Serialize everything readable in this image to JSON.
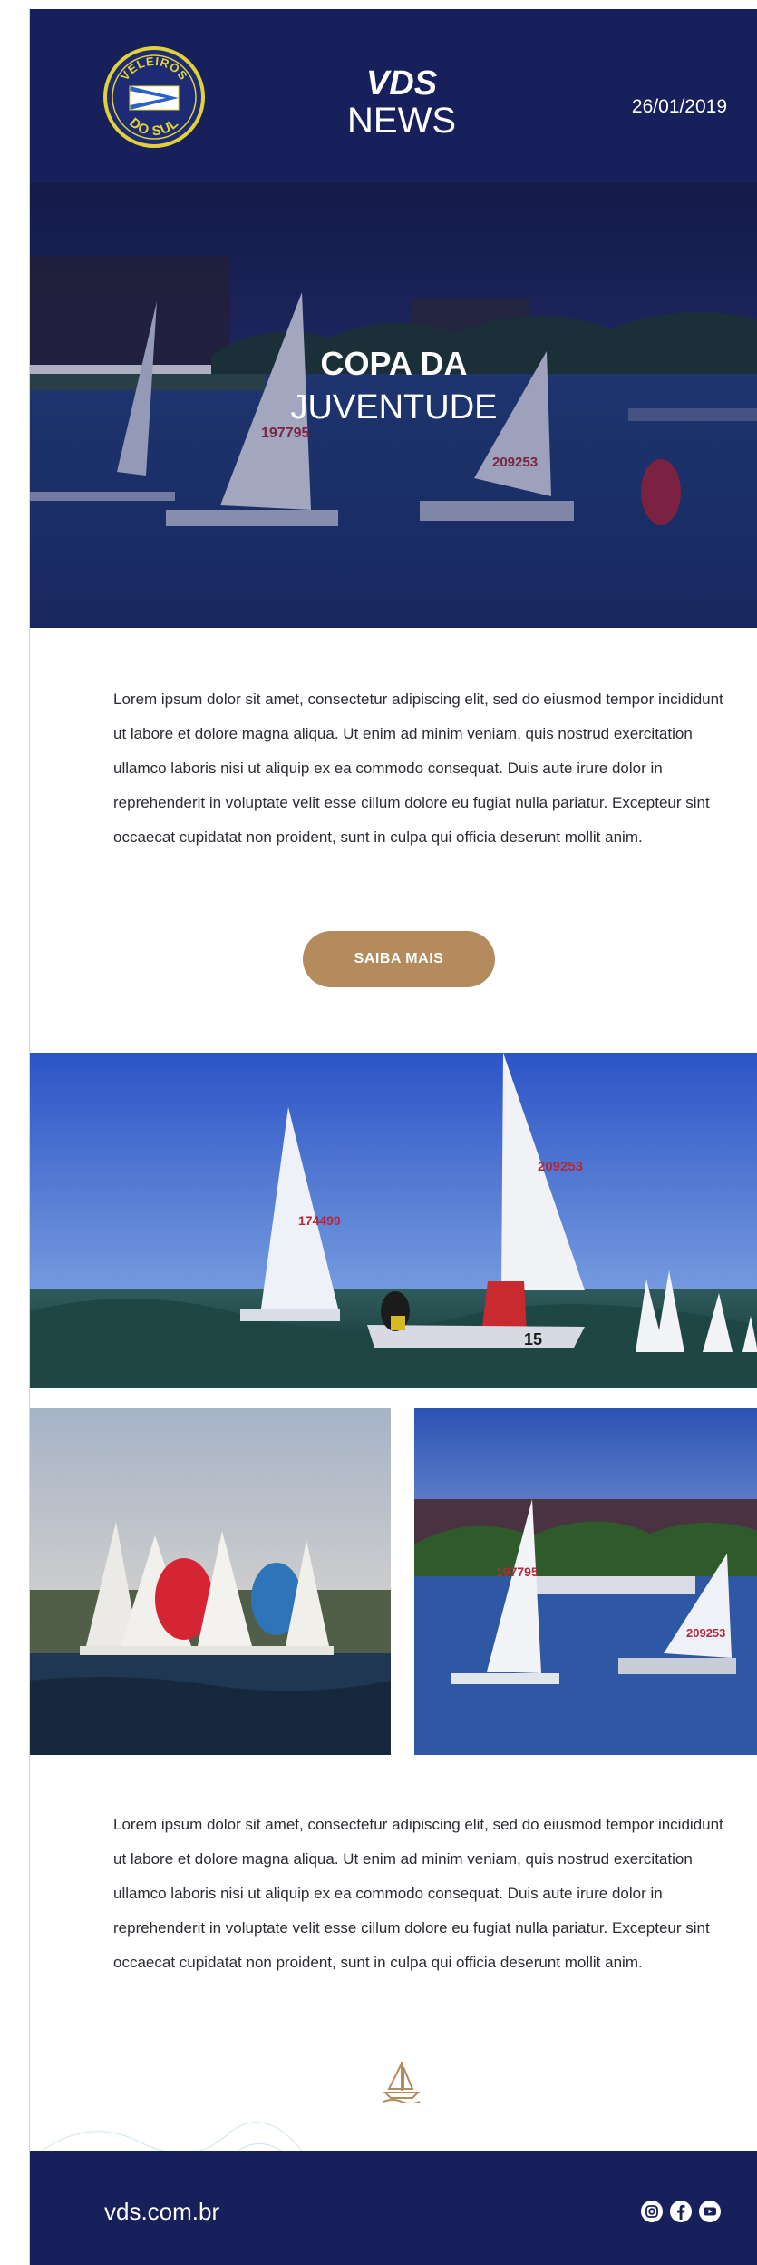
{
  "header": {
    "logo_text_top": "VELEIROS",
    "logo_text_bottom": "DO SUL",
    "brand_line1": "VDS",
    "brand_line2": "NEWS",
    "date": "26/01/2019"
  },
  "hero": {
    "title_line1": "COPA DA",
    "title_line2": "JUVENTUDE",
    "sail_numbers": [
      "197795",
      "209253"
    ]
  },
  "section1": {
    "body": "Lorem ipsum dolor sit amet, consectetur adipiscing elit, sed do eiusmod tempor incididunt ut labore et dolore magna aliqua. Ut enim ad minim veniam, quis nostrud exercitation ullamco laboris nisi ut aliquip ex ea commodo consequat. Duis aute irure dolor in reprehenderit in voluptate velit esse cillum dolore eu fugiat nulla pariatur. Excepteur sint occaecat cupidatat non proident, sunt in culpa qui officia deserunt mollit anim.",
    "button_label": "SAIBA MAIS"
  },
  "photos": {
    "wide_sail_numbers": [
      "174499",
      "209253",
      "15"
    ],
    "right_sail_numbers": [
      "197795",
      "209253"
    ]
  },
  "section2": {
    "body": "Lorem ipsum dolor sit amet, consectetur adipiscing elit, sed do eiusmod tempor incididunt ut labore et dolore magna aliqua. Ut enim ad minim veniam, quis nostrud exercitation ullamco laboris nisi ut aliquip ex ea commodo consequat. Duis aute irure dolor in reprehenderit in voluptate velit esse cillum dolore eu fugiat nulla pariatur. Excepteur sint occaecat cupidatat non proident, sunt in culpa qui officia deserunt mollit anim."
  },
  "footer": {
    "site": "vds.com.br",
    "social_icons": [
      "instagram-icon",
      "facebook-icon",
      "youtube-icon"
    ]
  },
  "colors": {
    "navy": "#17205a",
    "gold": "#b38b5d",
    "text": "#2b2b33"
  }
}
